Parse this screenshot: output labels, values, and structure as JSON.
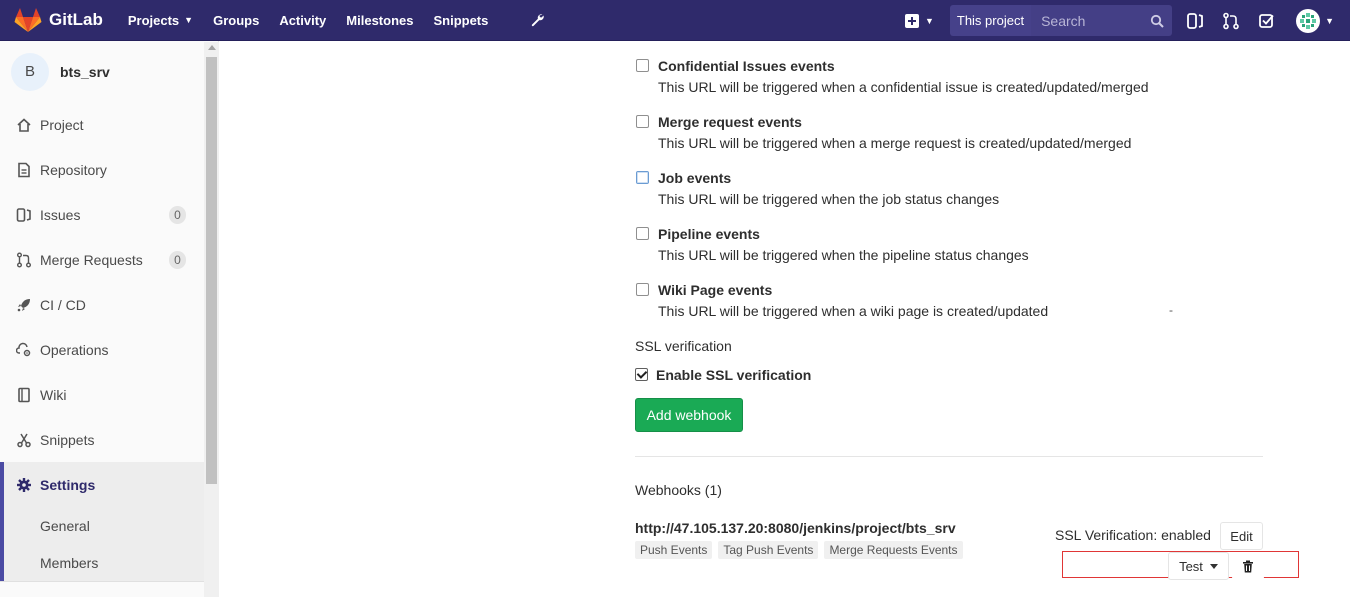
{
  "navbar": {
    "brand": "GitLab",
    "links": [
      {
        "label": "Projects",
        "has_caret": true
      },
      {
        "label": "Groups"
      },
      {
        "label": "Activity"
      },
      {
        "label": "Milestones"
      },
      {
        "label": "Snippets"
      }
    ],
    "search_scope": "This project",
    "search_placeholder": "Search",
    "accent": "#2f2a6b"
  },
  "sidebar": {
    "project_initial": "B",
    "project_name": "bts_srv",
    "items": [
      {
        "label": "Project",
        "icon": "home-icon"
      },
      {
        "label": "Repository",
        "icon": "doc-icon"
      },
      {
        "label": "Issues",
        "icon": "issues-icon",
        "badge": "0"
      },
      {
        "label": "Merge Requests",
        "icon": "merge-request-icon",
        "badge": "0"
      },
      {
        "label": "CI / CD",
        "icon": "rocket-icon"
      },
      {
        "label": "Operations",
        "icon": "cloud-gear-icon"
      },
      {
        "label": "Wiki",
        "icon": "book-icon"
      },
      {
        "label": "Snippets",
        "icon": "scissors-icon"
      },
      {
        "label": "Settings",
        "icon": "gear-icon",
        "active": true
      }
    ],
    "settings_sub": [
      "General",
      "Members"
    ]
  },
  "triggers": [
    {
      "label": "Confidential Issues events",
      "help": "This URL will be triggered when a confidential issue is created/updated/merged",
      "checked": false
    },
    {
      "label": "Merge request events",
      "help": "This URL will be triggered when a merge request is created/updated/merged",
      "checked": false
    },
    {
      "label": "Job events",
      "help": "This URL will be triggered when the job status changes",
      "checked": false
    },
    {
      "label": "Pipeline events",
      "help": "This URL will be triggered when the pipeline status changes",
      "checked": false
    },
    {
      "label": "Wiki Page events",
      "help": "This URL will be triggered when a wiki page is created/updated",
      "checked": false
    }
  ],
  "stray_mark": "-",
  "ssl": {
    "heading": "SSL verification",
    "checkbox_label": "Enable SSL verification",
    "checked": true
  },
  "add_webhook_label": "Add webhook",
  "webhooks": {
    "title": "Webhooks (1)",
    "items": [
      {
        "url": "http://47.105.137.20:8080/jenkins/project/bts_srv",
        "tags": [
          "Push Events",
          "Tag Push Events",
          "Merge Requests Events"
        ],
        "ssl_status": "SSL Verification: enabled",
        "edit_label": "Edit",
        "test_label": "Test"
      }
    ]
  },
  "colors": {
    "success": "#1aaa55",
    "highlight_border": "#e03636"
  }
}
